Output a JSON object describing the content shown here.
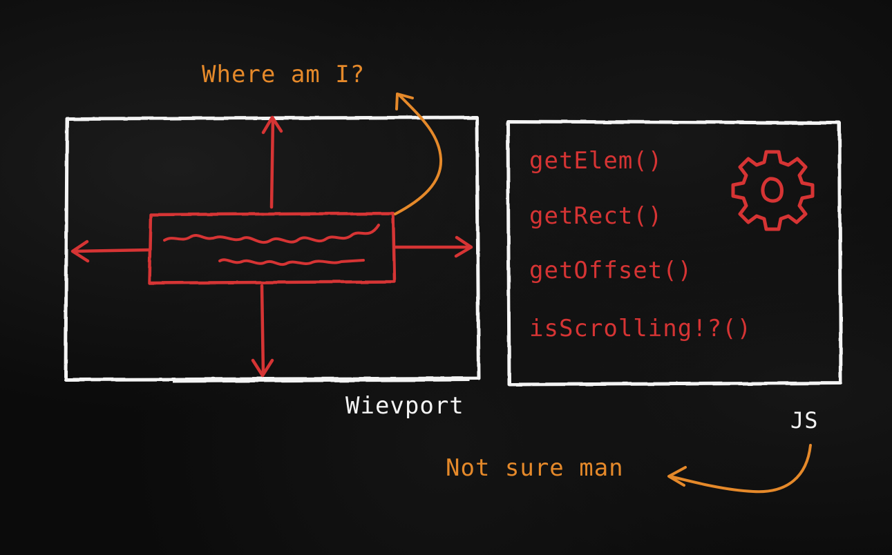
{
  "annotations": {
    "question": "Where am I?",
    "viewport_label": "Wievport",
    "js_label": "JS",
    "reply": "Not sure man"
  },
  "js_panel": {
    "functions": [
      "getElem()",
      "getRect()",
      "getOffset()",
      "isScrolling!?()"
    ],
    "icon": "gear-icon"
  },
  "colors": {
    "background": "#0b0b0b",
    "chalk_white": "#f4f4f4",
    "red": "#d63434",
    "orange": "#e5892a"
  }
}
